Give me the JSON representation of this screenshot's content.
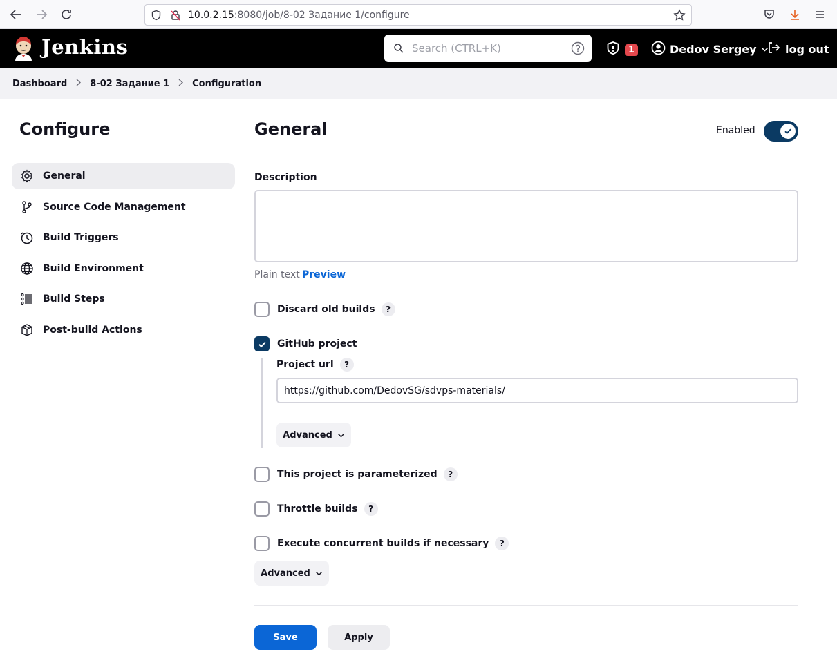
{
  "browser": {
    "url_host": "10.0.2.15",
    "url_rest": ":8080/job/8-02 Задание 1/configure"
  },
  "header": {
    "brand": "Jenkins",
    "search_placeholder": "Search (CTRL+K)",
    "security_count": "1",
    "user_name": "Dedov Sergey",
    "logout_label": "log out"
  },
  "breadcrumb": [
    "Dashboard",
    "8-02 Задание 1",
    "Configuration"
  ],
  "sidebar": {
    "title": "Configure",
    "items": [
      {
        "label": "General",
        "icon": "gear-icon",
        "active": true
      },
      {
        "label": "Source Code Management",
        "icon": "branch-icon",
        "active": false
      },
      {
        "label": "Build Triggers",
        "icon": "timer-icon",
        "active": false
      },
      {
        "label": "Build Environment",
        "icon": "globe-icon",
        "active": false
      },
      {
        "label": "Build Steps",
        "icon": "list-icon",
        "active": false
      },
      {
        "label": "Post-build Actions",
        "icon": "package-icon",
        "active": false
      }
    ]
  },
  "general": {
    "title": "General",
    "enabled_label": "Enabled",
    "enabled": true,
    "description_label": "Description",
    "description_value": "",
    "plain_text_label": "Plain text",
    "preview_label": "Preview",
    "options": [
      {
        "label": "Discard old builds",
        "checked": false
      },
      {
        "label": "GitHub project",
        "checked": true
      },
      {
        "label": "This project is parameterized",
        "checked": false
      },
      {
        "label": "Throttle builds",
        "checked": false
      },
      {
        "label": "Execute concurrent builds if necessary",
        "checked": false
      }
    ],
    "project_url_label": "Project url",
    "project_url_value": "https://github.com/DedovSG/sdvps-materials/",
    "advanced_label": "Advanced",
    "help_glyph": "?"
  },
  "footer": {
    "save_label": "Save",
    "apply_label": "Apply"
  },
  "colors": {
    "primary": "#0b66d6",
    "toggle_on": "#0b3a63",
    "header_bg": "#000000",
    "alert_badge": "#e5484d"
  }
}
